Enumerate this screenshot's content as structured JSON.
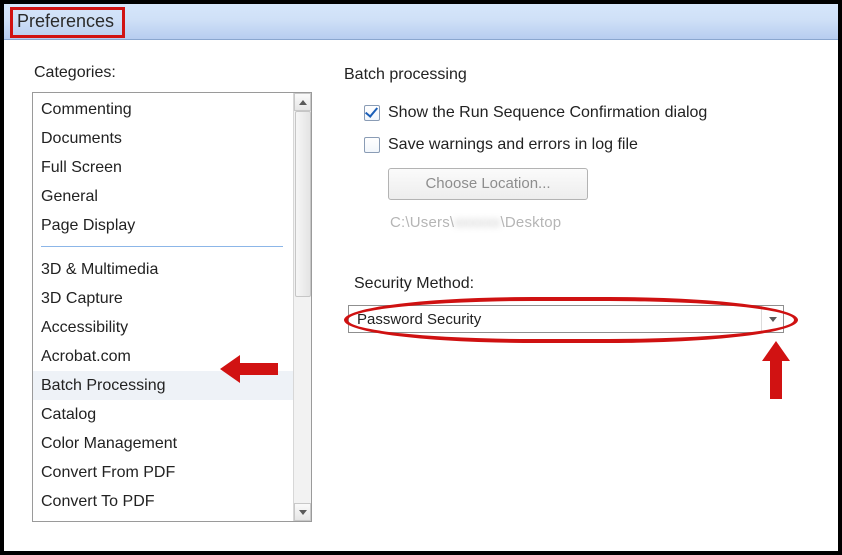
{
  "title": "Preferences",
  "left": {
    "heading": "Categories:",
    "group1": [
      "Commenting",
      "Documents",
      "Full Screen",
      "General",
      "Page Display"
    ],
    "group2": [
      "3D & Multimedia",
      "3D Capture",
      "Accessibility",
      "Acrobat.com",
      "Batch Processing",
      "Catalog",
      "Color Management",
      "Convert From PDF",
      "Convert To PDF"
    ],
    "selected": "Batch Processing"
  },
  "right": {
    "panel_title": "Batch processing",
    "opt_show_confirm": {
      "label": "Show the Run Sequence Confirmation dialog",
      "checked": true
    },
    "opt_save_log": {
      "label": "Save warnings and errors in log file",
      "checked": false
    },
    "choose_location_btn": "Choose Location...",
    "path_prefix": "C:\\Users\\",
    "path_blur": "xxxxxx",
    "path_suffix": "\\Desktop",
    "security_method_label": "Security Method:",
    "security_method_value": "Password Security"
  }
}
